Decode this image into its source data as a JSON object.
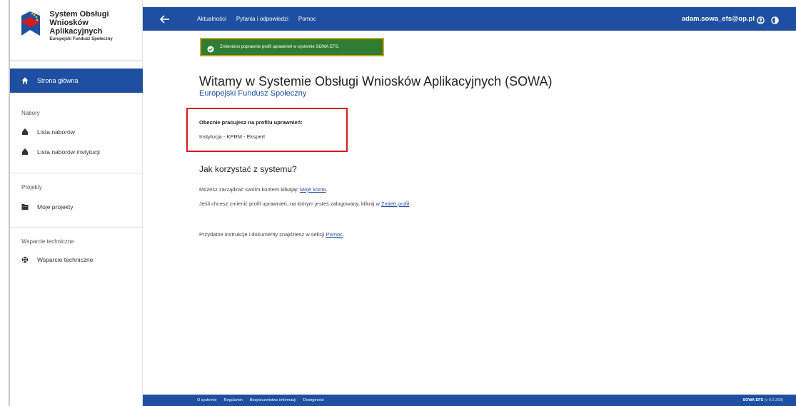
{
  "app": {
    "logo_line1": "System Obsługi",
    "logo_line2": "Wniosków Aplikacyjnych",
    "logo_line3": "Europejski Fundusz Społeczny"
  },
  "sidebar": {
    "home_label": "Strona główna",
    "sections": [
      {
        "label": "Nabory",
        "items": [
          {
            "label": "Lista naborów",
            "icon": "inbox-tray-icon"
          },
          {
            "label": "Lista naborów instytucji",
            "icon": "inbox-tray-icon"
          }
        ]
      },
      {
        "label": "Projekty",
        "items": [
          {
            "label": "Moje projekty",
            "icon": "folder-icon"
          }
        ]
      },
      {
        "label": "Wsparcie techniczne",
        "items": [
          {
            "label": "Wsparcie techniczne",
            "icon": "lifebuoy-icon"
          }
        ]
      }
    ]
  },
  "topbar": {
    "nav": [
      "Aktualności",
      "Pytania i odpowiedzi",
      "Pomoc"
    ],
    "user_email": "adam.sowa_efs@op.pl"
  },
  "notification": {
    "text": "Zmieniono poprawnie profil uprawnień w systemie SOWA EFS."
  },
  "main": {
    "title": "Witamy w Systemie Obsługi Wniosków Aplikacyjnych (SOWA)",
    "subtitle": "Europejski Fundusz Społeczny",
    "profile_label": "Obecnie pracujesz na profilu uprawnień:",
    "profile_value": "Instytucja - KPRM - Ekspert",
    "how_title": "Jak korzystać z systemu?",
    "para1_prefix": "Możesz zarządzać swoim kontem klikając",
    "para1_link": "Moje konto",
    "para1_suffix": ".",
    "para2_prefix": "Jeśli chcesz zmienić profil uprawnień, na którym jesteś zalogowany, kliknij w",
    "para2_link": "Zmień profil",
    "para2_suffix": ".",
    "para3_prefix": "Przydatne instrukcje i dokumenty znajdziesz w sekcji",
    "para3_link": "Pomoc",
    "para3_suffix": "."
  },
  "footer": {
    "links": [
      "O systemie",
      "Regulamin",
      "Bezpieczeństwo informacji",
      "Dostępność"
    ],
    "product": "SOWA EFS",
    "version": "(v 0.0.258)"
  },
  "colors": {
    "primary": "#1f4fa0",
    "success": "#2e7d32",
    "highlight_border": "#d7191c"
  }
}
